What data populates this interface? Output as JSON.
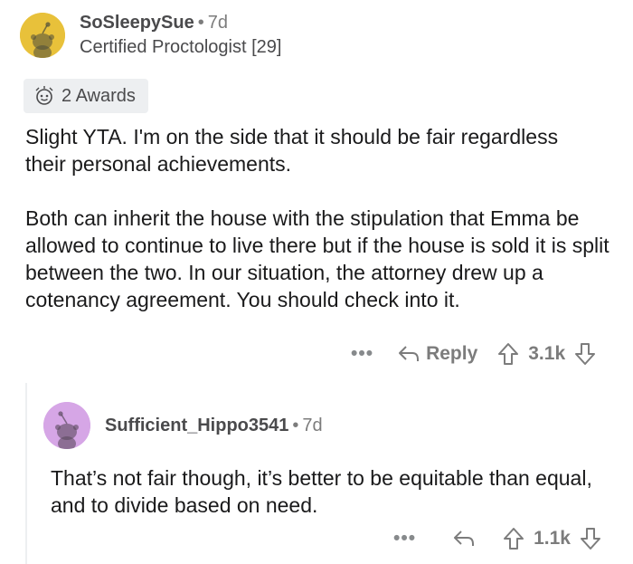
{
  "top_comment": {
    "username": "SoSleepySue",
    "time": "7d",
    "flair": "Certified Proctologist [29]",
    "awards_label": "2 Awards",
    "paragraph_1": "Slight YTA.  I'm on the side that it should be fair regardless their personal achievements.",
    "paragraph_2": "Both can inherit the house with the stipulation that Emma be allowed to continue to live there but if the house is sold it is split between the two.  In our situation, the attorney drew up a cotenancy agreement. You should check into it.",
    "more": "•••",
    "reply_label": "Reply",
    "score": "3.1k",
    "avatar_color": "#e8c13a"
  },
  "reply_comment": {
    "username": "Sufficient_Hippo3541",
    "time": "7d",
    "body": "That’s not fair though, it’s better to be equitable than equal, and to divide based on need.",
    "more": "•••",
    "score": "1.1k",
    "avatar_color": "#d6a6e6"
  }
}
